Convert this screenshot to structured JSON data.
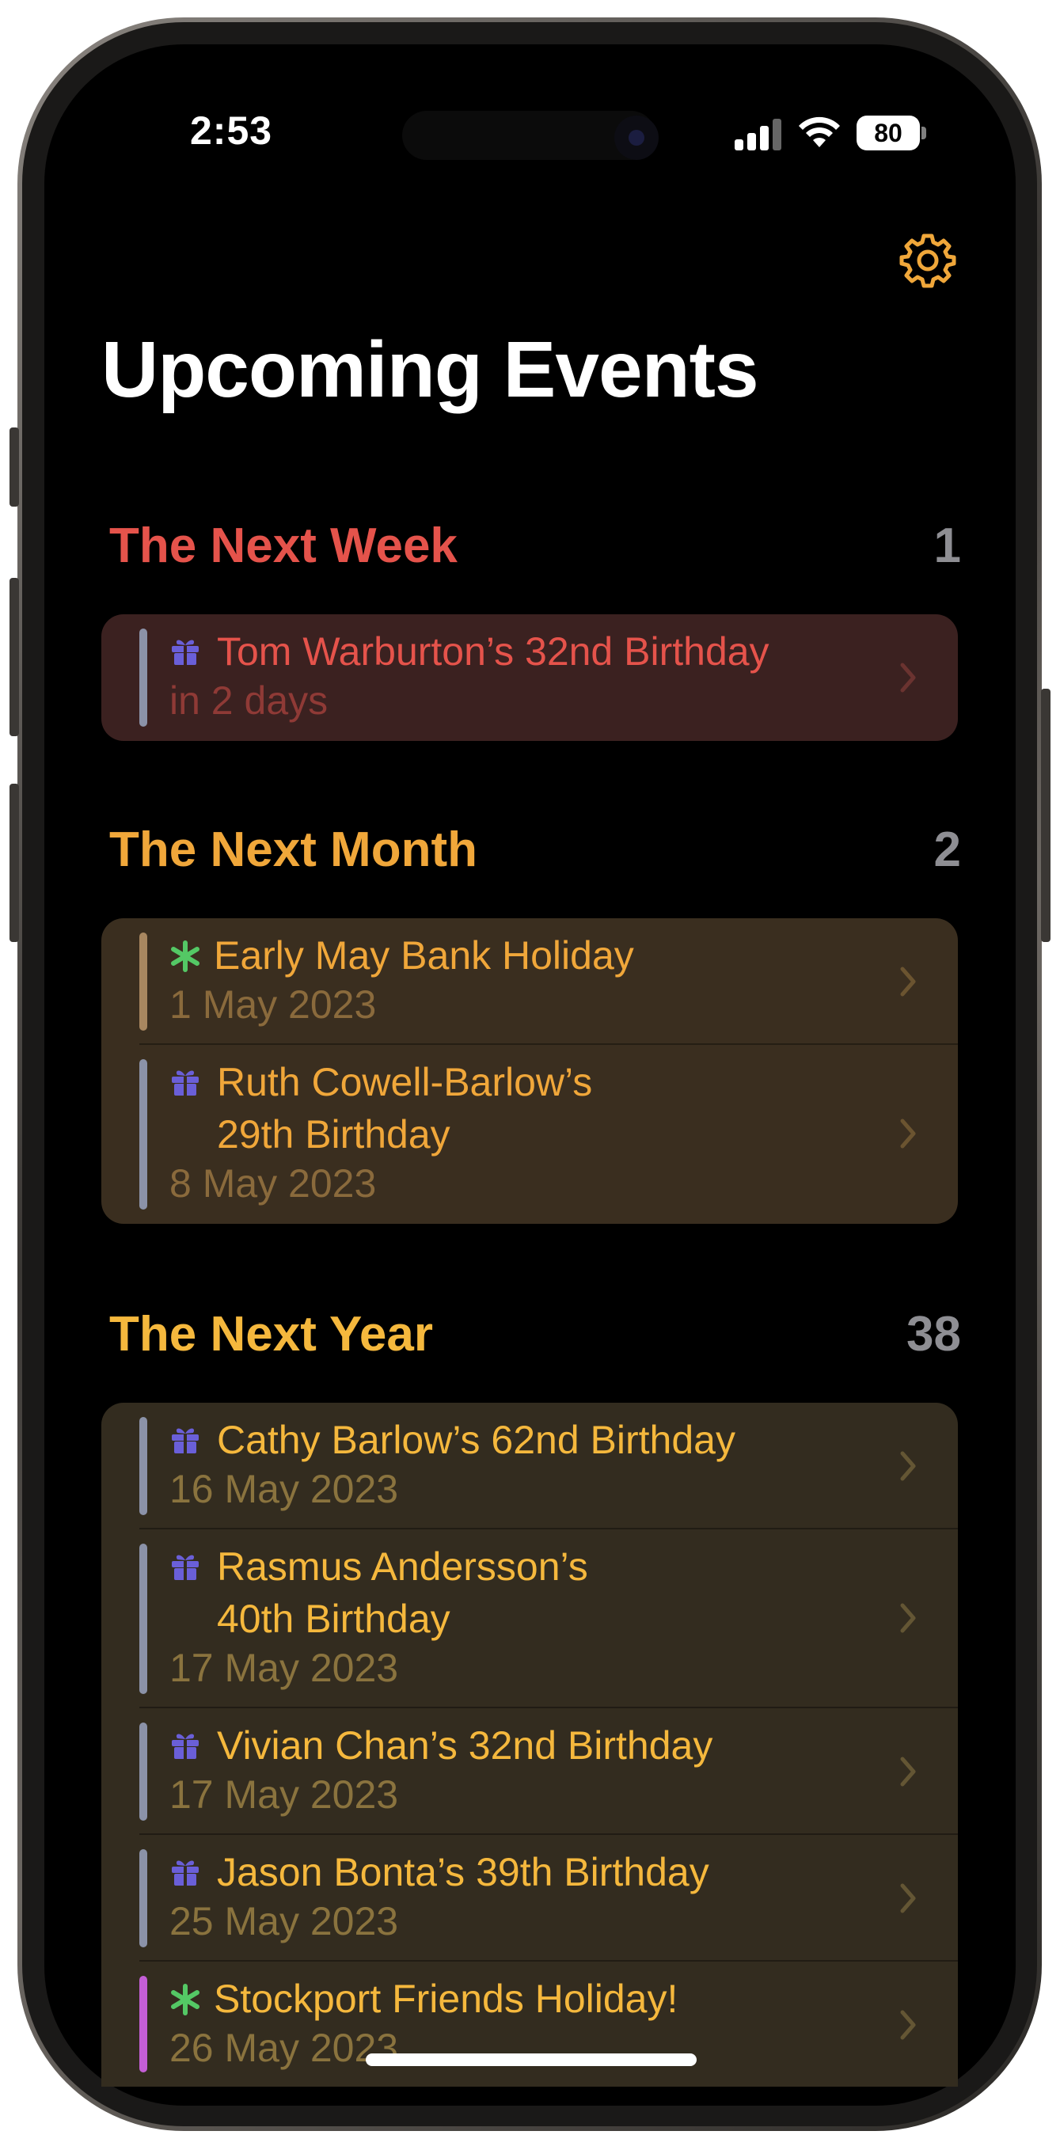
{
  "status_bar": {
    "time": "2:53",
    "battery": "80"
  },
  "header": {
    "title": "Upcoming Events",
    "settings_icon": "gear-icon"
  },
  "colors": {
    "week_accent": "#e5534b",
    "month_accent": "#f0a73a",
    "year_accent": "#f5b83d",
    "birthday_icon": "#6a5fd8",
    "holiday_icon": "#54c865"
  },
  "sections": [
    {
      "title": "The Next Week",
      "count": "1",
      "items": [
        {
          "icon": "gift-icon",
          "title": "Tom Warburton’s 32nd Birthday",
          "date": "in 2 days"
        }
      ]
    },
    {
      "title": "The Next Month",
      "count": "2",
      "items": [
        {
          "icon": "asterisk-icon",
          "title": "Early May Bank Holiday",
          "date": "1 May 2023"
        },
        {
          "icon": "gift-icon",
          "title_line1": "Ruth Cowell-Barlow’s",
          "title_line2": "29th Birthday",
          "date": "8 May 2023"
        }
      ]
    },
    {
      "title": "The Next Year",
      "count": "38",
      "items": [
        {
          "icon": "gift-icon",
          "title": "Cathy Barlow’s 62nd Birthday",
          "date": "16 May 2023"
        },
        {
          "icon": "gift-icon",
          "title_line1": "Rasmus Andersson’s",
          "title_line2": "40th Birthday",
          "date": "17 May 2023"
        },
        {
          "icon": "gift-icon",
          "title": "Vivian Chan’s 32nd Birthday",
          "date": "17 May 2023"
        },
        {
          "icon": "gift-icon",
          "title": "Jason Bonta’s 39th Birthday",
          "date": "25 May 2023"
        },
        {
          "icon": "asterisk-icon",
          "title": "Stockport Friends Holiday!",
          "date": "26 May 2023"
        }
      ]
    }
  ]
}
